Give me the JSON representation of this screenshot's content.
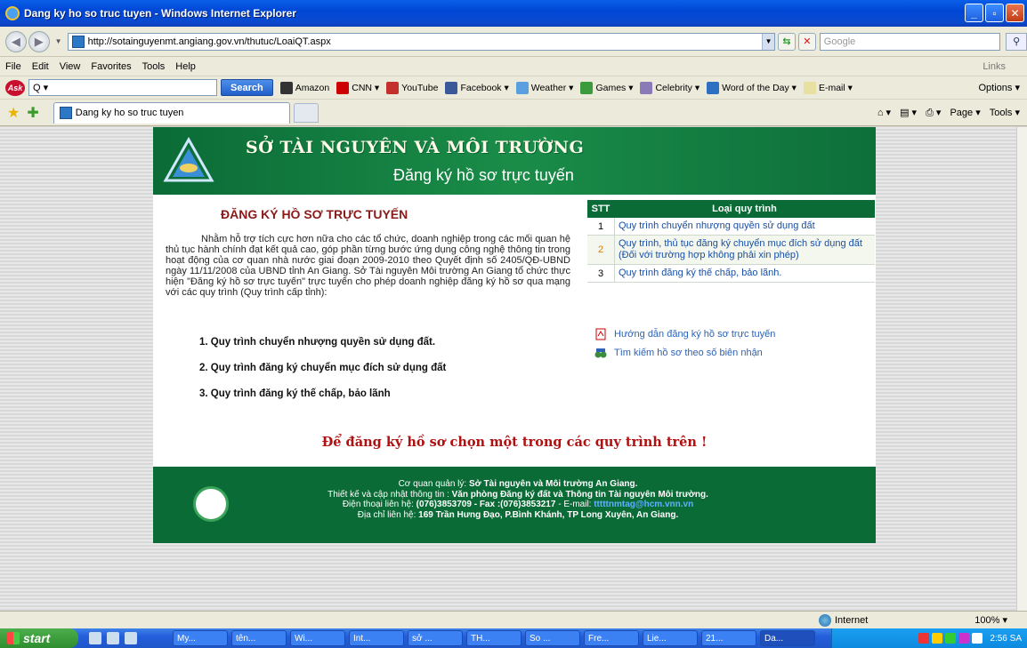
{
  "window": {
    "title": "Dang ky ho so truc tuyen - Windows Internet Explorer"
  },
  "address": {
    "url": "http://sotainguyenmt.angiang.gov.vn/thutuc/LoaiQT.aspx",
    "search_placeholder": "Google"
  },
  "menu": {
    "items": [
      "File",
      "Edit",
      "View",
      "Favorites",
      "Tools",
      "Help"
    ],
    "links_label": "Links"
  },
  "ask_toolbar": {
    "search_label": "Search",
    "items": [
      "Amazon",
      "CNN ▾",
      "YouTube",
      "Facebook ▾",
      "Weather ▾",
      "Games ▾",
      "Celebrity ▾",
      "Word of the Day ▾",
      "E-mail ▾"
    ],
    "options_label": "Options ▾"
  },
  "tab": {
    "label": "Dang ky ho so truc tuyen"
  },
  "commands": {
    "page_label": "Page ▾",
    "tools_label": "Tools ▾"
  },
  "site": {
    "org_name": "SỞ TÀI NGUYÊN VÀ MÔI TRƯỜNG",
    "tagline": "Đăng ký hồ sơ trực tuyến",
    "heading": "ĐĂNG KÝ HỒ SƠ TRỰC TUYẾN",
    "intro": "Nhằm hỗ trợ tích cực hơn nữa cho các tổ chức, doanh nghiệp trong các mối quan hệ thủ tục hành chính đạt kết quả cao, góp phần từng bước ứng dụng công nghệ thông tin trong hoạt động của cơ quan nhà nước giai đoạn 2009-2010 theo Quyết định số 2405/QĐ-UBND ngày 11/11/2008 của UBND tỉnh An Giang. Sở Tài nguyên Môi trường An Giang tổ chức thực hiện \"Đăng ký hồ sơ trực tuyến\" trực tuyến cho phép doanh nghiệp đăng ký hồ sơ qua mạng với các quy trình (Quy trình cấp tỉnh):",
    "procedures": [
      "1. Quy trình chuyển nhượng quyền sử dụng đất.",
      "2. Quy trình đăng ký chuyển mục đích sử dụng đất",
      "3. Quy trình đăng ký thế chấp, bảo lãnh"
    ],
    "table": {
      "col_stt": "STT",
      "col_type": "Loại quy trình",
      "rows": [
        {
          "stt": "1",
          "name": "Quy trình chuyển nhượng quyền sử dụng đất"
        },
        {
          "stt": "2",
          "name": "Quy trình, thủ tục đăng ký chuyển mục đích sử dụng đất (Đối với trường hợp không phải xin phép)"
        },
        {
          "stt": "3",
          "name": "Quy trình đăng ký thế chấp, bảo lãnh."
        }
      ]
    },
    "links": [
      "Hướng dẫn đăng ký hồ sơ trực tuyến",
      "Tìm kiếm hồ sơ theo số biên nhận"
    ],
    "cta": "Để đăng ký hồ sơ chọn một trong các quy trình trên !",
    "footer": {
      "line1_label": "Cơ quan quản lý: ",
      "line1_value": "Sở Tài nguyên và Môi trường An Giang.",
      "line2_label": "Thiết kế và cập nhật thông tin : ",
      "line2_value": "Văn phòng Đăng ký đất và Thông tin Tài nguyên Môi trường.",
      "line3_label": "Điện thoại liên hệ: ",
      "line3_value": "(076)3853709 - Fax :(076)3853217",
      "line3_email_label": " - E-mail: ",
      "line3_email": "tttttnmtag@hcm.vnn.vn",
      "line4_label": "Địa chỉ liên hệ: ",
      "line4_value": "169 Trần Hưng Đạo, P.Bình Khánh, TP Long Xuyên, An Giang."
    }
  },
  "status": {
    "zone": "Internet",
    "zoom": "100%"
  },
  "taskbar": {
    "start": "start",
    "buttons": [
      "My...",
      "tên...",
      "Wi...",
      "Int...",
      "sở ...",
      "TH...",
      "So ...",
      "Fre...",
      "Lie...",
      "21...",
      "Da..."
    ],
    "clock": "2:56 SA"
  }
}
